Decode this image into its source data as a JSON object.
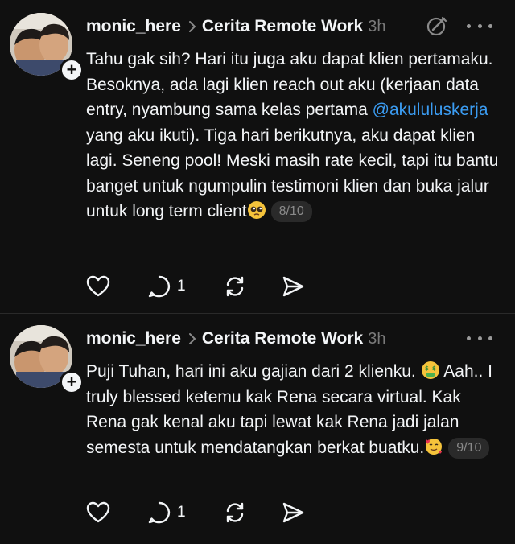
{
  "posts": [
    {
      "username": "monic_here",
      "community": "Cerita Remote Work",
      "time": "3h",
      "text_before": "Tahu gak sih? Hari itu juga aku dapat klien pertamaku. Besoknya, ada lagi klien reach out aku (kerjaan data entry, nyambung sama kelas pertama ",
      "mention": "@akululuskerja",
      "text_after": " yang aku ikuti). Tiga hari berikutnya, aku dapat klien lagi. Seneng pool! Meski masih rate kecil, tapi itu bantu banget untuk ngumpulin testimoni klien dan buka jalur untuk long term client",
      "emoji": "pleading-face",
      "page": "8/10",
      "reply_count": "1"
    },
    {
      "username": "monic_here",
      "community": "Cerita Remote Work",
      "time": "3h",
      "text_before": "Puji Tuhan, hari ini aku gajian dari 2 klienku. ",
      "emoji_inline": "money-mouth-face",
      "text_after": " Aah.. I truly blessed ketemu kak Rena secara virtual. Kak Rena gak kenal aku tapi lewat kak Rena jadi jalan semesta untuk mendatangkan berkat buatku.",
      "emoji": "smiling-face-with-hearts",
      "page": "9/10",
      "reply_count": "1"
    }
  ],
  "colors": {
    "background": "#101010",
    "text": "#f3f5f7",
    "muted": "#7a7a7a",
    "mention": "#3b9cf2",
    "pill": "#2a2a2a"
  }
}
